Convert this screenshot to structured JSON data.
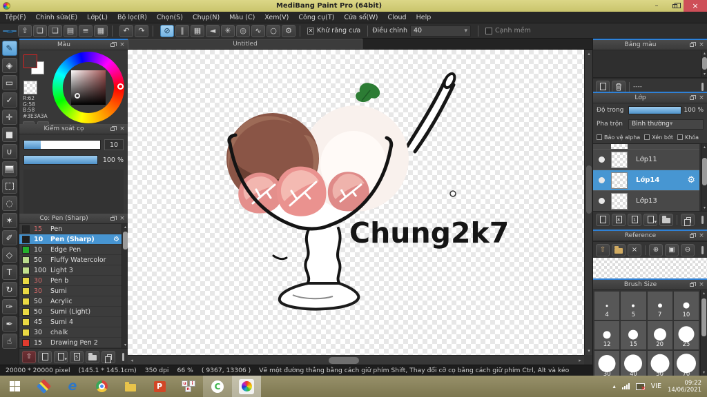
{
  "window": {
    "title": "MediBang Paint Pro (64bit)",
    "minimize_glyph": "–",
    "close_glyph": "×"
  },
  "menu": {
    "items": [
      "Tệp(F)",
      "Chỉnh sửa(E)",
      "Lớp(L)",
      "Bộ lọc(R)",
      "Chọn(S)",
      "Chụp(N)",
      "Màu (C)",
      "Xem(V)",
      "Công cụ(T)",
      "Cửa sổ(W)",
      "Cloud",
      "Help"
    ]
  },
  "toolbar": {
    "files": [
      {
        "glyph": "☁",
        "name": "cloud-upload-button",
        "accent": true
      },
      {
        "glyph": "⇧",
        "name": "publish-button"
      },
      {
        "glyph": "❏",
        "name": "comment-button"
      },
      {
        "glyph": "❑",
        "name": "comment-settings-button"
      },
      {
        "glyph": "▤",
        "name": "document-button"
      },
      {
        "glyph": "≡",
        "name": "list-button"
      },
      {
        "glyph": "▦",
        "name": "material-button"
      }
    ],
    "history": [
      {
        "glyph": "↶",
        "name": "undo-button"
      },
      {
        "glyph": "↷",
        "name": "redo-button"
      }
    ],
    "snap": [
      {
        "glyph": "⊘",
        "name": "snap-off-button",
        "active": true
      },
      {
        "glyph": "∥",
        "name": "snap-parallel-button"
      },
      {
        "glyph": "▦",
        "name": "snap-grid-button"
      },
      {
        "glyph": "◄",
        "name": "snap-vanishing-point-button"
      },
      {
        "glyph": "✳",
        "name": "snap-radial-button"
      },
      {
        "glyph": "◎",
        "name": "snap-concentric-button"
      },
      {
        "glyph": "∿",
        "name": "snap-curve-button"
      },
      {
        "glyph": "○",
        "name": "snap-ellipse-button"
      },
      {
        "glyph": "⚙",
        "name": "snap-settings-button"
      }
    ],
    "antialias_label": "Khử răng cưa",
    "adjust_label": "Điều chỉnh",
    "adjust_value": "40",
    "soft_edge_label": "Cạnh mềm"
  },
  "tool_rail": {
    "tools": [
      {
        "glyph": "✎",
        "name": "brush-tool",
        "selected": true
      },
      {
        "glyph": "◈",
        "name": "eraser-tool"
      },
      {
        "glyph": "▭",
        "name": "figure-tool"
      },
      {
        "glyph": "✓",
        "name": "dot-pen-tool"
      },
      {
        "glyph": "✛",
        "name": "move-tool"
      },
      {
        "glyph": "■",
        "name": "fill-rect-tool"
      },
      {
        "glyph": "∪",
        "name": "bucket-tool"
      },
      {
        "glyph": "",
        "name": "gradient-tool",
        "gradient": true
      },
      {
        "glyph": "",
        "name": "select-marquee-tool",
        "dashed": true
      },
      {
        "glyph": "◌",
        "name": "lasso-tool"
      },
      {
        "glyph": "✶",
        "name": "magic-wand-tool"
      },
      {
        "glyph": "✐",
        "name": "select-pen-tool"
      },
      {
        "glyph": "◇",
        "name": "select-eraser-tool"
      },
      {
        "glyph": "T",
        "name": "text-tool"
      },
      {
        "glyph": "↻",
        "name": "rotate-view-tool"
      },
      {
        "glyph": "✑",
        "name": "pen-tool"
      },
      {
        "glyph": "✒",
        "name": "eyedropper-tool"
      },
      {
        "glyph": "☝",
        "name": "hand-tool"
      }
    ]
  },
  "color_panel": {
    "title": "Màu",
    "r": "R:62",
    "g": "G:58",
    "b": "B:58",
    "hex": "#3E3A3A"
  },
  "brush_control": {
    "title": "Kiểm soát cọ",
    "size_value": "10",
    "opacity_value": "100 %"
  },
  "brush_panel": {
    "title": "Cọ: Pen (Sharp)",
    "badge_s": "S",
    "brushes": [
      {
        "size": "15",
        "name": "Pen",
        "color": "#262626",
        "red_num": true
      },
      {
        "size": "10",
        "name": "Pen (Sharp)",
        "color": "#1f1f1f",
        "selected": true
      },
      {
        "size": "10",
        "name": "Edge Pen",
        "color": "#25b02c"
      },
      {
        "size": "50",
        "name": "Fluffy Watercolor",
        "color": "#b9db8c"
      },
      {
        "size": "100",
        "name": "Light 3",
        "color": "#c3e08e"
      },
      {
        "size": "30",
        "name": "Pen b",
        "color": "#ead943",
        "red_num": true
      },
      {
        "size": "30",
        "name": "Sumi",
        "color": "#ead943",
        "red_num": true
      },
      {
        "size": "50",
        "name": "Acrylic",
        "color": "#ead943"
      },
      {
        "size": "50",
        "name": "Sumi (Light)",
        "color": "#ead943"
      },
      {
        "size": "45",
        "name": "Sumi 4",
        "color": "#ead943"
      },
      {
        "size": "30",
        "name": "chalk",
        "color": "#ead943"
      },
      {
        "size": "15",
        "name": "Drawing Pen 2",
        "color": "#e23b2e"
      }
    ]
  },
  "canvas": {
    "tab": "Untitled",
    "signature": "Chung2k7"
  },
  "palette_panel": {
    "title": "Bảng màu",
    "dashes": "----"
  },
  "layers_panel": {
    "title": "Lớp",
    "opacity_label": "Độ trong",
    "opacity_value": "100 %",
    "blend_label": "Pha trộn",
    "blend_value": "Bình thường",
    "check1": "Bảo vệ alpha",
    "check2": "Xén bớt",
    "check3": "Khóa",
    "badge_8": "8",
    "badge_1": "1",
    "layers": [
      {
        "name": "Lớp11"
      },
      {
        "name": "Lớp14",
        "selected": true
      },
      {
        "name": "Lớp13"
      }
    ]
  },
  "reference_panel": {
    "title": "Reference"
  },
  "brush_size_panel": {
    "title": "Brush Size",
    "sizes": [
      {
        "label": "4",
        "dot": 3
      },
      {
        "label": "5",
        "dot": 4
      },
      {
        "label": "7",
        "dot": 6
      },
      {
        "label": "10",
        "dot": 9
      },
      {
        "label": "12",
        "dot": 11
      },
      {
        "label": "15",
        "dot": 14
      },
      {
        "label": "20",
        "dot": 18
      },
      {
        "label": "25",
        "dot": 23
      },
      {
        "label": "30",
        "dot": 25
      },
      {
        "label": "40",
        "dot": 26
      },
      {
        "label": "50",
        "dot": 27
      },
      {
        "label": "70",
        "dot": 28
      }
    ]
  },
  "status_bar": {
    "size": "20000 * 20000 pixel",
    "cm": "(145.1 * 145.1cm)",
    "dpi": "350 dpi",
    "zoom": "66 %",
    "coords": "( 9367, 13306 )",
    "hint": "Vẽ một đường thẳng bằng cách giữ phím Shift, Thay đổi cỡ cọ bằng cách giữ phím Ctrl, Alt và kéo"
  },
  "taskbar": {
    "ie_glyph": "e",
    "ppt_glyph": "P",
    "coccoc_glyph": "C",
    "unikey_u": "u",
    "unikey_i": "i",
    "unikey_n": "n",
    "lang": "VIE",
    "time": "09:22",
    "date": "14/06/2021"
  }
}
